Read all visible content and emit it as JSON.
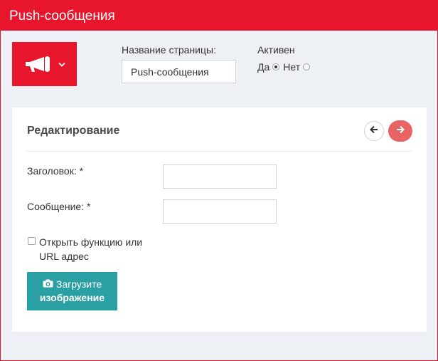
{
  "header": {
    "title": "Push-сообщения"
  },
  "icon_picker": {
    "icon": "megaphone-icon",
    "dropdown_icon": "chevron-down-icon"
  },
  "page_name": {
    "label": "Название страницы:",
    "value": "Push-сообщения"
  },
  "active": {
    "label": "Активен",
    "options": [
      {
        "label": "Да",
        "checked": true
      },
      {
        "label": "Нет",
        "checked": false
      }
    ]
  },
  "editor": {
    "title": "Редактирование",
    "prev_icon": "arrow-left-icon",
    "next_icon": "arrow-right-icon",
    "fields": [
      {
        "label": "Заголовок: *",
        "value": ""
      },
      {
        "label": "Сообщение: *",
        "value": ""
      }
    ],
    "checkbox": {
      "label": "Открыть функцию или URL адрес",
      "checked": false
    },
    "upload_button": {
      "icon": "camera-icon",
      "line1": "Загрузите",
      "line2": "изображение"
    }
  },
  "colors": {
    "brand_red": "#e8162c",
    "next_button": "#e86464",
    "upload_teal": "#2aa0a4",
    "background": "#edf0f4"
  }
}
